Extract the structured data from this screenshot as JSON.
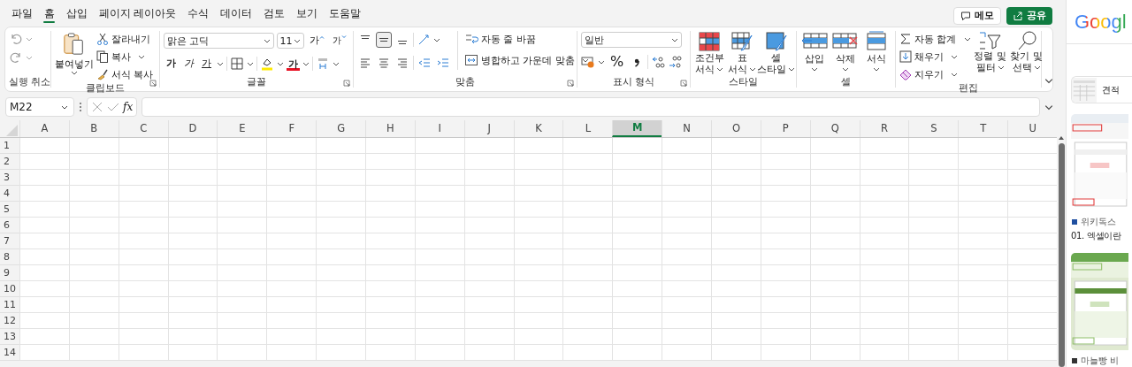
{
  "menu_tabs": [
    {
      "label": "파일",
      "selected": false
    },
    {
      "label": "홈",
      "selected": true
    },
    {
      "label": "삽입",
      "selected": false
    },
    {
      "label": "페이지 레이아웃",
      "selected": false
    },
    {
      "label": "수식",
      "selected": false
    },
    {
      "label": "데이터",
      "selected": false
    },
    {
      "label": "검토",
      "selected": false
    },
    {
      "label": "보기",
      "selected": false
    },
    {
      "label": "도움말",
      "selected": false
    }
  ],
  "header_buttons": [
    {
      "kind": "comment",
      "label": "메모"
    },
    {
      "kind": "share",
      "label": "공유"
    }
  ],
  "ribbon": {
    "undo": {
      "label": "실행 취소"
    },
    "clipboard": {
      "label": "클립보드",
      "paste": "붙여넣기",
      "cut": "잘라내기",
      "copy": "복사",
      "format_painter": "서식 복사"
    },
    "font": {
      "label": "글꼴",
      "font_name": "맑은 고딕",
      "font_size": "11",
      "grow": "가",
      "shrink": "가",
      "bold": "가",
      "italic": "가",
      "underline": "가",
      "font_color": "가"
    },
    "alignment": {
      "label": "맞춤",
      "vertical": [
        {
          "selected": false
        },
        {
          "selected": true
        },
        {
          "selected": false
        }
      ],
      "wrap_text": "자동 줄 바꿈",
      "merge": "병합하고 가운데 맞춤"
    },
    "number": {
      "label": "표시 형식",
      "format": "일반",
      "percent": "%"
    },
    "styles": {
      "label": "스타일",
      "buttons": [
        {
          "kind": "conditional",
          "lines": [
            "조건부",
            "서식"
          ]
        },
        {
          "kind": "table",
          "lines": [
            "표",
            "서식"
          ]
        },
        {
          "kind": "cell",
          "lines": [
            "셀",
            "스타일"
          ]
        }
      ]
    },
    "cells": {
      "label": "셀",
      "buttons": [
        {
          "kind": "insert",
          "label": "삽입"
        },
        {
          "kind": "delete",
          "label": "삭제"
        },
        {
          "kind": "format",
          "label": "서식"
        }
      ]
    },
    "editing": {
      "label": "편집",
      "autosum": "자동 합계",
      "fill": "채우기",
      "clear": "지우기",
      "sort_filter": [
        "정렬 및",
        "필터"
      ],
      "find_select": [
        "찾기 및",
        "선택"
      ]
    }
  },
  "formula_bar": {
    "name_box": "M22",
    "function_label": "fx"
  },
  "sheet": {
    "columns": [
      {
        "label": "A",
        "selected": false
      },
      {
        "label": "B",
        "selected": false
      },
      {
        "label": "C",
        "selected": false
      },
      {
        "label": "D",
        "selected": false
      },
      {
        "label": "E",
        "selected": false
      },
      {
        "label": "F",
        "selected": false
      },
      {
        "label": "G",
        "selected": false
      },
      {
        "label": "H",
        "selected": false
      },
      {
        "label": "I",
        "selected": false
      },
      {
        "label": "J",
        "selected": false
      },
      {
        "label": "K",
        "selected": false
      },
      {
        "label": "L",
        "selected": false
      },
      {
        "label": "M",
        "selected": true
      },
      {
        "label": "N",
        "selected": false
      },
      {
        "label": "O",
        "selected": false
      },
      {
        "label": "P",
        "selected": false
      },
      {
        "label": "Q",
        "selected": false
      },
      {
        "label": "R",
        "selected": false
      },
      {
        "label": "S",
        "selected": false
      },
      {
        "label": "T",
        "selected": false
      },
      {
        "label": "U",
        "selected": false
      }
    ],
    "rows": [
      "1",
      "2",
      "3",
      "4",
      "5",
      "6",
      "7",
      "8",
      "9",
      "10",
      "11",
      "12",
      "13",
      "14"
    ]
  },
  "side_panel": {
    "logo": "Googl",
    "top_result": "견적",
    "images": [
      {
        "source": "위키독스",
        "caption": "01. 엑셀이란"
      },
      {
        "source": "마늘빵 비"
      }
    ]
  }
}
